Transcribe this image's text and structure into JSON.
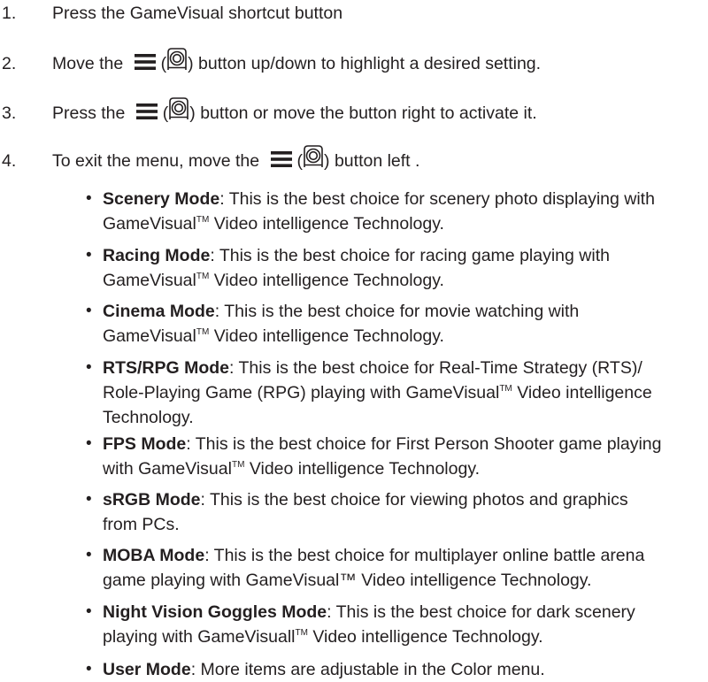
{
  "steps": [
    {
      "num": "1.",
      "text": "Press the GameVisual shortcut button"
    },
    {
      "num": "2.",
      "before": "Move the",
      "middle_open": "(",
      "after": ") button up/down to highlight a desired setting."
    },
    {
      "num": "3.",
      "before": "Press the",
      "middle_open": "(",
      "after": ") button or move the button right to activate it."
    },
    {
      "num": "4.",
      "before": "To exit the menu, move the",
      "middle_open": "(",
      "after": ") button left ."
    }
  ],
  "modes": [
    {
      "name": "Scenery Mode",
      "lines": [
        ": This is the best choice for scenery photo displaying with",
        "GameVisual|TM| Video intelligence Technology."
      ]
    },
    {
      "name": "Racing Mode",
      "lines": [
        ": This is the best choice for racing game playing with",
        "GameVisual|TM| Video intelligence Technology."
      ]
    },
    {
      "name": "Cinema Mode",
      "lines": [
        ": This is the best choice for movie watching with",
        "GameVisual|TM| Video intelligence Technology."
      ]
    },
    {
      "name": "RTS/RPG Mode",
      "lines": [
        ": This is the best choice for Real-Time Strategy (RTS)/",
        "Role-Playing Game (RPG) playing with GameVisual|TM| Video intelligence",
        "Technology."
      ]
    },
    {
      "name": "FPS Mode",
      "lines": [
        ": This is the best choice for First Person Shooter game playing",
        "with GameVisual|TM| Video intelligence Technology."
      ]
    },
    {
      "name": "sRGB Mode",
      "lines": [
        ": This is the best choice for viewing photos and graphics",
        "from PCs."
      ]
    },
    {
      "name": "MOBA Mode",
      "lines": [
        ": This is the best choice for multiplayer online battle arena",
        "game playing with GameVisual™ Video intelligence Technology."
      ]
    },
    {
      "name": "Night Vision Goggles Mode",
      "lines": [
        ": This is the best choice for dark scenery",
        "playing with GameVisuall|TM| Video intelligence Technology."
      ]
    },
    {
      "name": "User Mode",
      "lines": [
        ": More items are adjustable in the Color menu."
      ]
    }
  ],
  "icons": {
    "menu_button": "menu-lines-icon",
    "joystick_button": "joystick-button-icon"
  }
}
